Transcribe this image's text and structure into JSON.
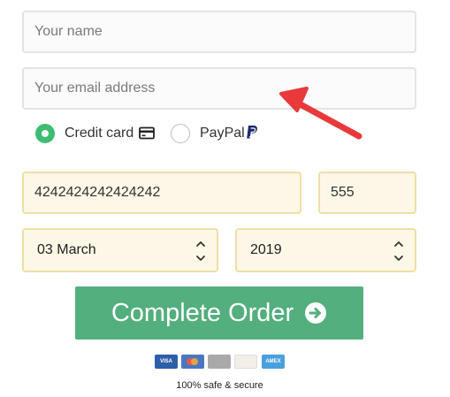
{
  "form": {
    "name_placeholder": "Your name",
    "email_placeholder": "Your email address",
    "payment_methods": {
      "credit_card_label": "Credit card",
      "paypal_label": "PayPal",
      "selected": "Credit card"
    },
    "card_number": "4242424242424242",
    "cvc": "555",
    "expiry_month": "03 March",
    "expiry_year": "2019",
    "submit_label": "Complete Order"
  },
  "footer": {
    "card_logos": [
      "VISA",
      "mastercard",
      "card",
      "DISCOVER",
      "AMEX"
    ],
    "secure_text": "100% safe & secure"
  },
  "colors": {
    "accent_green": "#53af7d",
    "radio_green": "#3ebd72",
    "annotation_red": "#e83a3a",
    "field_highlight": "#fcf7e6"
  },
  "icons": [
    "credit-card-icon",
    "paypal-icon",
    "arrow-circle-right-icon",
    "select-chevron-icon"
  ]
}
